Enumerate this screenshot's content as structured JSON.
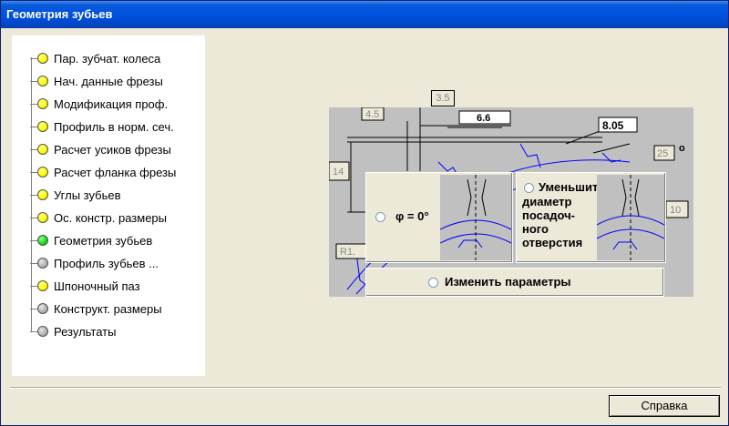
{
  "window": {
    "title": "Геометрия зубьев"
  },
  "tree": {
    "items": [
      {
        "label": "Пар. зубчат. колеса",
        "status": "yellow"
      },
      {
        "label": "Нач. данные фрезы",
        "status": "yellow"
      },
      {
        "label": "Модификация проф.",
        "status": "yellow"
      },
      {
        "label": "Профиль в норм. сеч.",
        "status": "yellow"
      },
      {
        "label": "Расчет усиков фрезы",
        "status": "yellow"
      },
      {
        "label": "Расчет фланка фрезы",
        "status": "yellow"
      },
      {
        "label": "Углы зубьев",
        "status": "yellow"
      },
      {
        "label": "Ос. констр. размеры",
        "status": "yellow"
      },
      {
        "label": "Геометрия зубьев",
        "status": "green"
      },
      {
        "label": "Профиль зубьев ...",
        "status": "gray"
      },
      {
        "label": "Шпоночный паз",
        "status": "yellow"
      },
      {
        "label": "Конструкт. размеры",
        "status": "gray"
      },
      {
        "label": "Результаты",
        "status": "gray"
      }
    ]
  },
  "diagram": {
    "dims": {
      "d45": "4.5",
      "d35": "3.5",
      "d66": "6.6",
      "d805": "8.05",
      "d25": "25",
      "deg": "o",
      "d14": "14",
      "d10": "10",
      "r1": "R1."
    }
  },
  "options": {
    "phi_zero": "φ = 0°",
    "reduce_line1": "Уменьшить",
    "reduce_line2": "диаметр",
    "reduce_line3": "посадоч-",
    "reduce_line4": "ного",
    "reduce_line5": "отверстия",
    "change_params": "Изменить параметры"
  },
  "buttons": {
    "help": "Справка"
  },
  "colors": {
    "title_bar": "#0054e3",
    "active_status": "#22dd22",
    "diagram_lines": "#0000ff"
  }
}
